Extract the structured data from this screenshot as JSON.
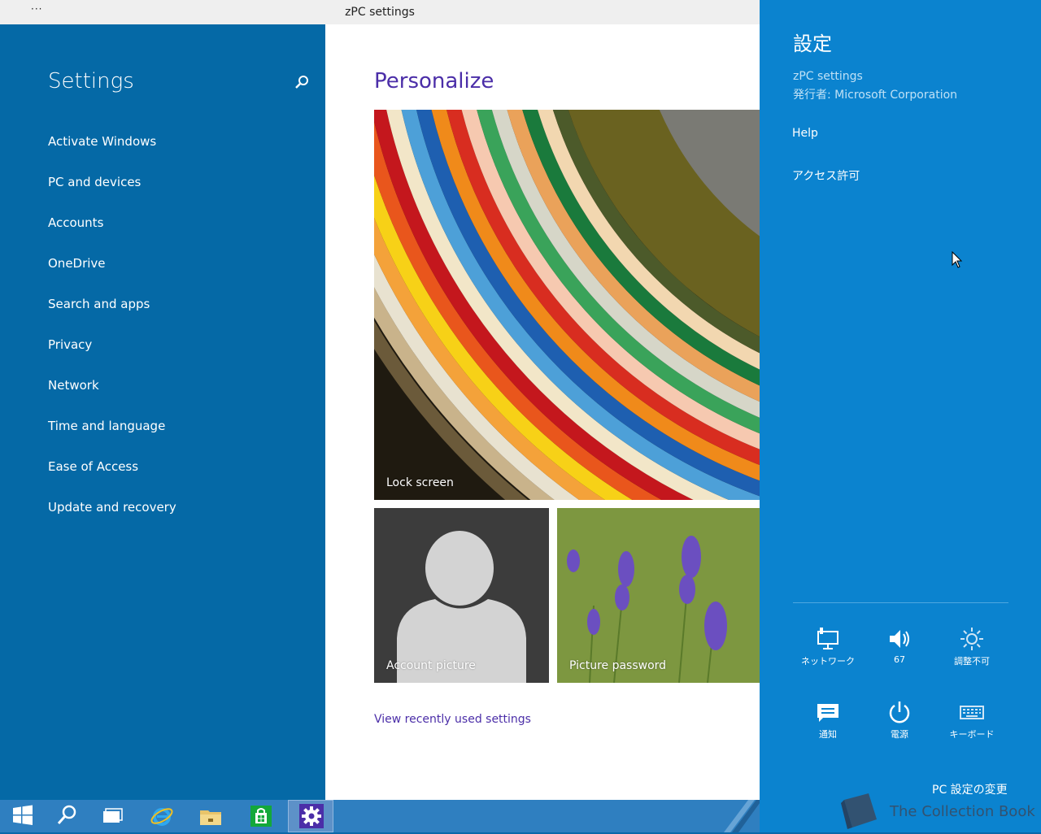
{
  "window": {
    "title": "zPC settings",
    "menu_glyph": "···"
  },
  "sidebar": {
    "heading": "Settings",
    "items": [
      {
        "label": "Activate Windows"
      },
      {
        "label": "PC and devices"
      },
      {
        "label": "Accounts"
      },
      {
        "label": "OneDrive"
      },
      {
        "label": "Search and apps"
      },
      {
        "label": "Privacy"
      },
      {
        "label": "Network"
      },
      {
        "label": "Time and language"
      },
      {
        "label": "Ease of Access"
      },
      {
        "label": "Update and recovery"
      }
    ]
  },
  "main": {
    "title": "Personalize",
    "tiles": {
      "lock_screen": "Lock screen",
      "account_picture": "Account picture",
      "picture_password": "Picture password"
    },
    "recent_link": "View recently used settings"
  },
  "charm": {
    "title": "設定",
    "app_name": "zPC settings",
    "publisher": "発行者: Microsoft Corporation",
    "help": "Help",
    "permissions": "アクセス許可",
    "quick": {
      "network": "ネットワーク",
      "volume": "67",
      "brightness": "調整不可",
      "notifications": "通知",
      "power": "電源",
      "keyboard": "キーボード"
    },
    "change_pc_settings": "PC 設定の変更",
    "watermark": "The Collection Book"
  },
  "colors": {
    "sidebar": "#0569a6",
    "charm": "#0b83cf",
    "accent_text": "#4b2ea8",
    "taskbar": "#2f7fc0"
  },
  "taskbar": {
    "icons": [
      "windows-start-icon",
      "search-icon",
      "task-view-icon",
      "internet-explorer-icon",
      "file-explorer-icon",
      "store-icon",
      "settings-gear-icon"
    ]
  }
}
